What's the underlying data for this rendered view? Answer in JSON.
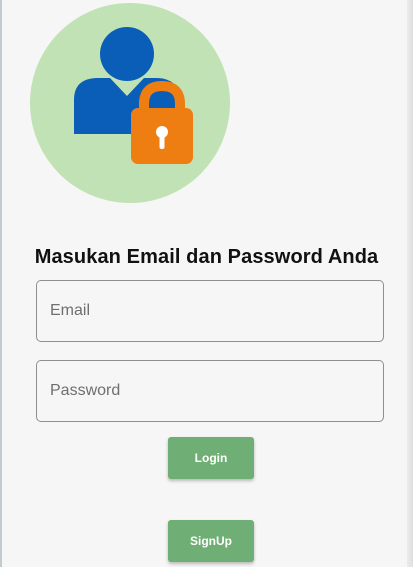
{
  "logo": {
    "icon": "user-lock-icon",
    "circle_color": "#c1e2b4",
    "user_color": "#0b5eb8",
    "lock_color": "#ef7e12"
  },
  "heading": "Masukan Email dan Password Anda",
  "email_field": {
    "placeholder": "Email",
    "value": ""
  },
  "password_field": {
    "placeholder": "Password",
    "value": ""
  },
  "buttons": {
    "login_label": "Login",
    "signup_label": "SignUp",
    "color": "#6fae74"
  }
}
